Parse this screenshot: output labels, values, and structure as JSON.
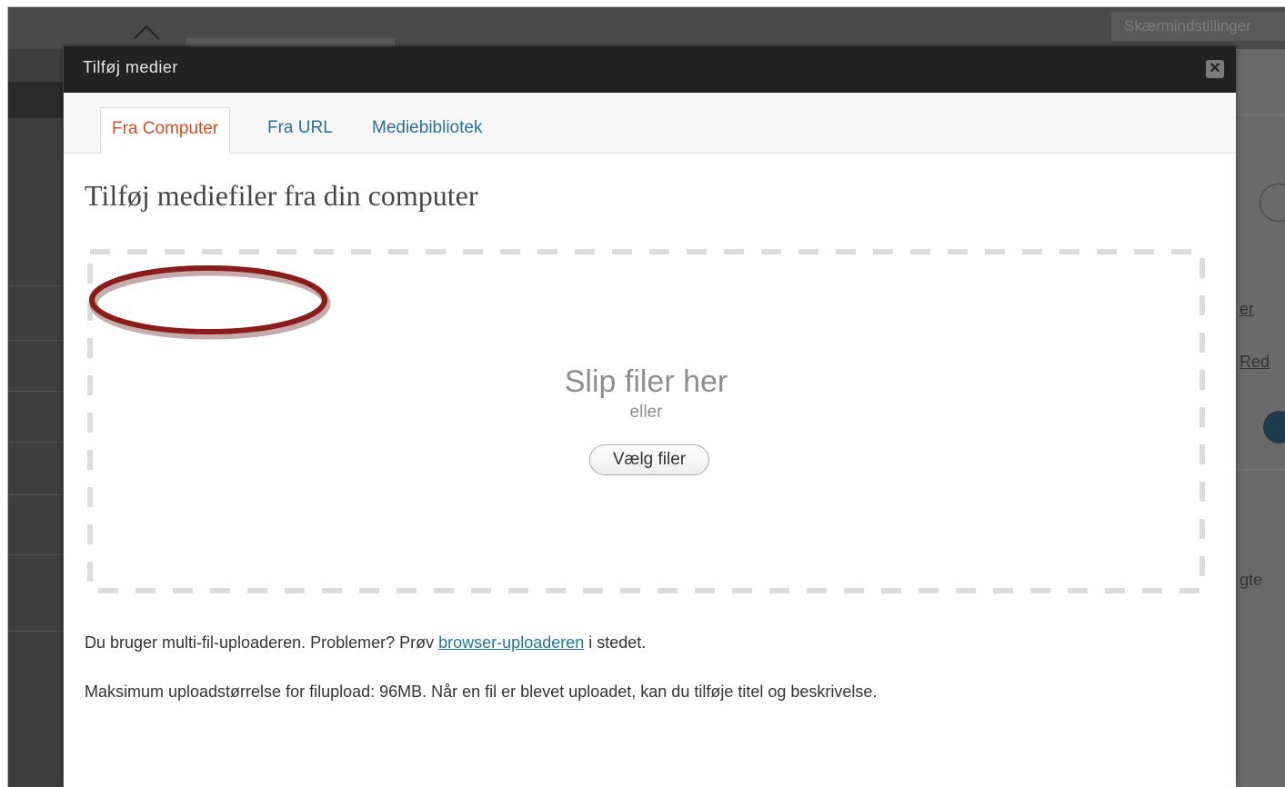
{
  "background": {
    "screen_options_label": "Skærmindstillinger",
    "right_fragments": [
      "er",
      "Red",
      "gte"
    ]
  },
  "modal": {
    "title": "Tilføj medier",
    "close_symbol": "✕",
    "tabs": [
      {
        "label": "Fra Computer",
        "active": true
      },
      {
        "label": "Fra URL",
        "active": false
      },
      {
        "label": "Mediebibliotek",
        "active": false
      }
    ],
    "heading": "Tilføj mediefiler fra din computer",
    "dropzone": {
      "drop_text": "Slip filer her",
      "or_text": "eller",
      "button_label": "Vælg filer"
    },
    "uploader_note": {
      "prefix": "Du bruger multi-fil-uploaderen. Problemer? Prøv ",
      "link": "browser-uploaderen",
      "suffix": " i stedet."
    },
    "max_size_note": "Maksimum uploadstørrelse for filupload: 96MB. Når en fil er blevet uploadet, kan du tilføje titel og beskrivelse."
  },
  "colors": {
    "active_tab": "#d54e21",
    "link": "#21759b",
    "annotation_ring": "#8b1c1c",
    "header_bg": "#222222"
  }
}
